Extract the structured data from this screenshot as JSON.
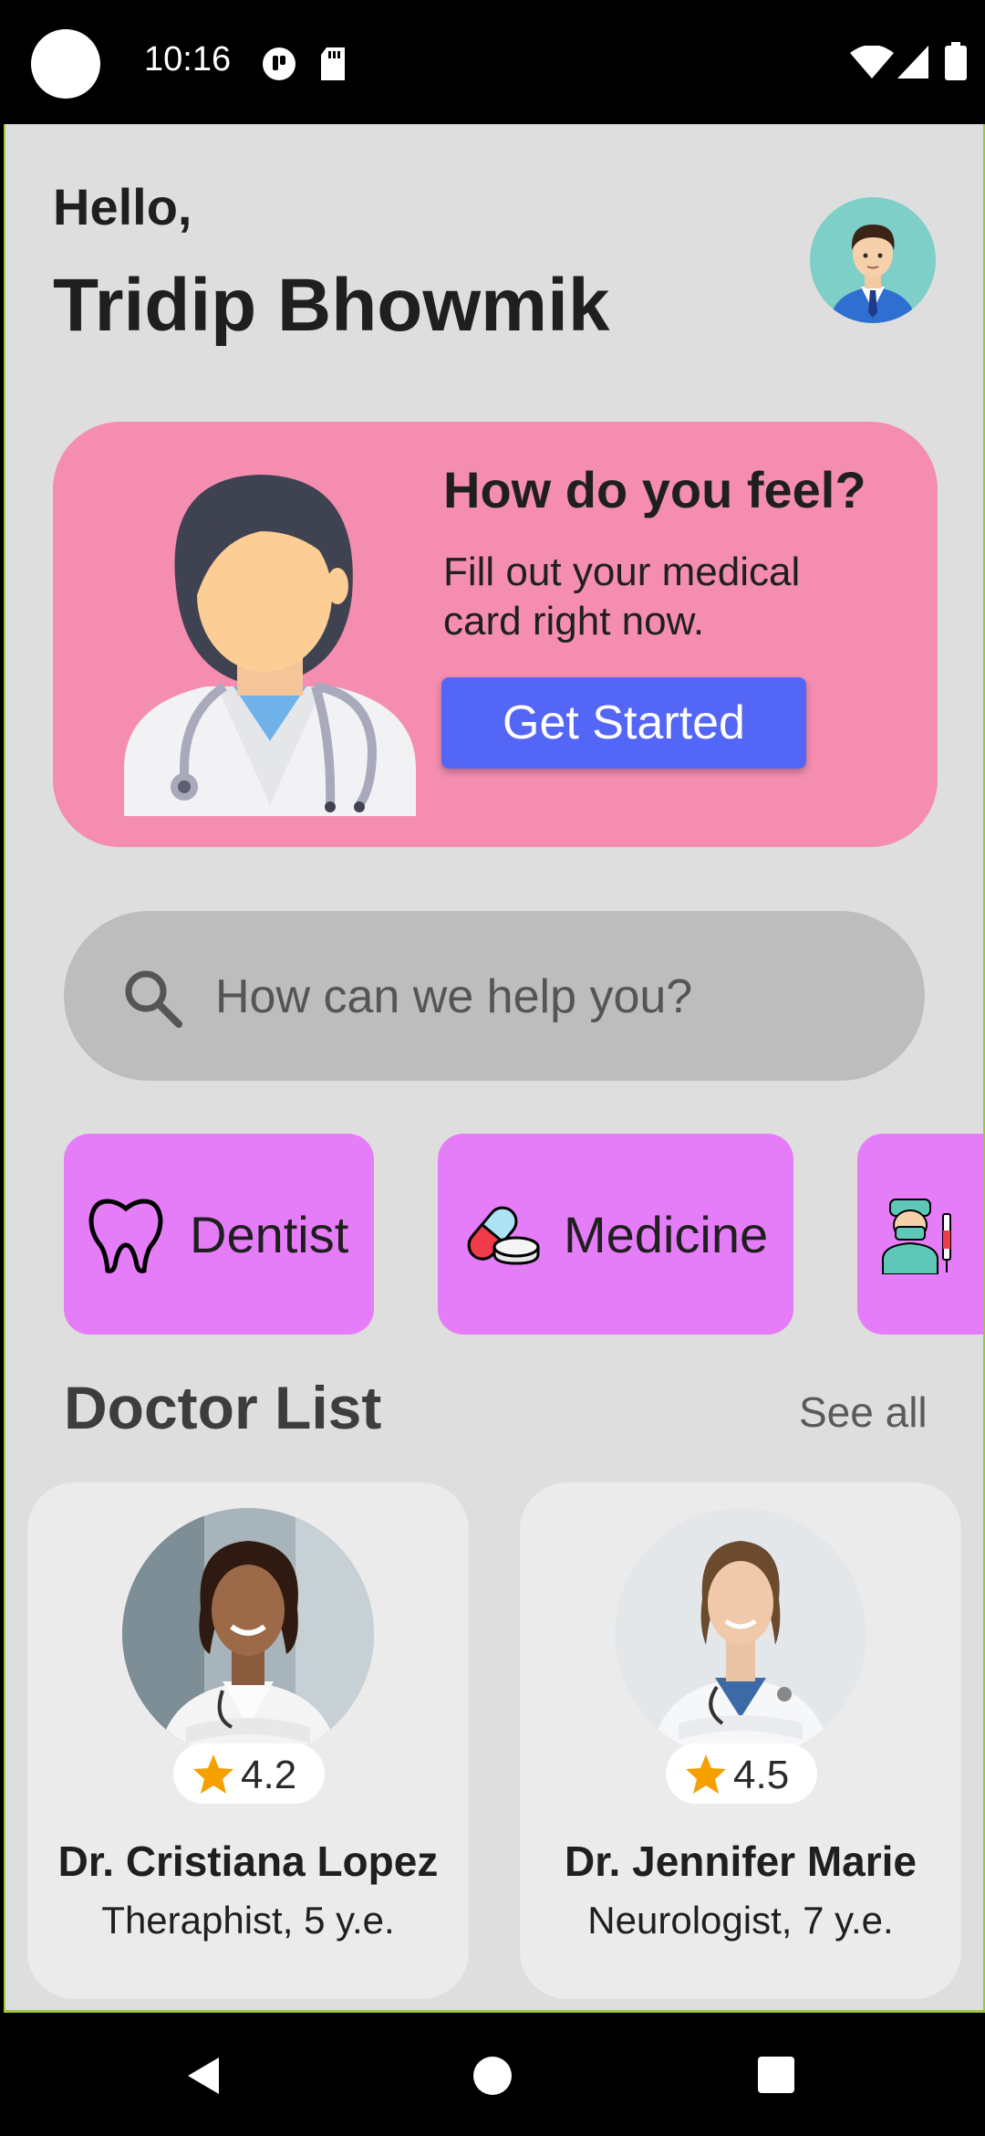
{
  "status_bar": {
    "time": "10:16",
    "icons": [
      "camera-dot-icon",
      "notification-icon",
      "sd-card-icon",
      "wifi-icon",
      "signal-icon",
      "battery-icon"
    ]
  },
  "header": {
    "greeting": "Hello,",
    "user_name": "Tridip Bhowmik",
    "avatar_icon": "user-avatar-icon"
  },
  "promo": {
    "title": "How do you feel?",
    "text": "Fill out your medical card right now.",
    "button_label": "Get Started",
    "illustration": "doctor-illustration-icon",
    "bg_color": "#f48db0",
    "button_color": "#5466f5"
  },
  "search": {
    "placeholder": "How can we help you?",
    "value": "",
    "icon": "search-icon"
  },
  "categories": [
    {
      "label": "Dentist",
      "icon": "tooth-icon"
    },
    {
      "label": "Medicine",
      "icon": "pills-icon"
    },
    {
      "label": "",
      "icon": "surgeon-icon"
    }
  ],
  "doctor_list": {
    "title": "Doctor List",
    "see_all": "See all",
    "doctors": [
      {
        "name": "Dr. Cristiana Lopez",
        "specialty": "Theraphist, 5 y.e.",
        "rating": "4.2"
      },
      {
        "name": "Dr. Jennifer Marie",
        "specialty": "Neurologist, 7 y.e.",
        "rating": "4.5"
      }
    ]
  },
  "nav_bar": {
    "icons": [
      "back-icon",
      "home-icon",
      "recents-icon"
    ]
  },
  "colors": {
    "screen_bg": "#dedede",
    "category_bg": "#e67df8",
    "card_bg": "#ebebeb",
    "star": "#f6a000"
  }
}
